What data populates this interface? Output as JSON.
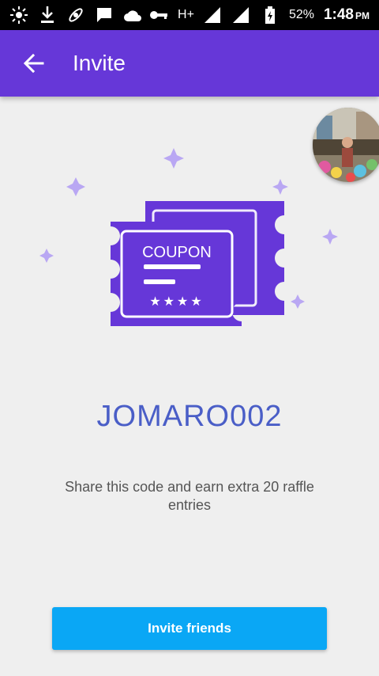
{
  "status_bar": {
    "battery": "52%",
    "time": "1:48",
    "ampm": "PM",
    "network": "H+",
    "icons": [
      "brightness-icon",
      "download-icon",
      "satellite-icon",
      "message-icon",
      "cloud-icon",
      "key-icon",
      "signal-icon",
      "battery-icon"
    ]
  },
  "app_bar": {
    "title": "Invite",
    "back_icon": "arrow-back-icon",
    "color": "#6637d8"
  },
  "coupon": {
    "label": "COUPON",
    "stars": "★★★★",
    "color": "#6637d8",
    "sparkle_color": "#b9a7f3"
  },
  "invite": {
    "code": "JOMARO002",
    "description": "Share this code and earn extra 20 raffle entries",
    "button_label": "Invite friends",
    "button_color": "#0aa7f5",
    "code_color": "#4a5ec7"
  }
}
